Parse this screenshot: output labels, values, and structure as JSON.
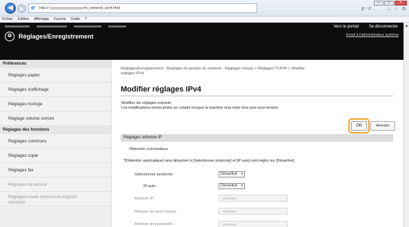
{
  "browser": {
    "url_prefix": "http://",
    "url_suffix": "/m_network_ipv4.html",
    "search_glyphs": "ρ - c",
    "win_min": "—",
    "win_max": "□",
    "win_close": "✕"
  },
  "menubar": [
    "Fichier",
    "Edition",
    "Affichage",
    "Favoris",
    "Outils",
    "?"
  ],
  "header": {
    "portal_link": "Vers le portail",
    "logout_link": "Se déconnecter",
    "admin_email": "Email à l'administrateur système",
    "app_title": "Réglages/Enregistrement"
  },
  "sidebar": {
    "sec1": "Préférences",
    "sec1_items": [
      "Réglages papier",
      "Réglages d'affichage",
      "Réglages horloge",
      "Réglage volume sonore"
    ],
    "sec2": "Réglages des fonctions",
    "sec2_items": [
      "Réglages communs",
      "Réglages copie",
      "Réglages fax",
      "Réglages de lecture"
    ],
    "sec2_last_line1": "Réglages mode impression support",
    "sec2_last_line2": "mémoire"
  },
  "main": {
    "breadcrumb_line1": "Réglages/Enregistrement : Réglages de gestion du système : Réglages réseau > Réglages TCP/IP > Modifier",
    "breadcrumb_line2": "réglages IPv4",
    "title": "Modifier réglages IPv4",
    "desc1": "Modifiez les réglages suivants.",
    "desc2": "Les modifications seront prises en compte lorsque la machine sera mise hors puis sous tension.",
    "ok": "OK",
    "cancel": "Annuler",
    "section": "Réglages adresse IP",
    "auto_label": "Obtention automatique",
    "note": "*[Obtention automatique] sera désactivé si [Sélectionner protocole] et [IP auto] sont réglés sur [Désactivé].",
    "protocol_label": "Sélectionner protocole :",
    "protocol_value": "Désactivé",
    "autoip_label": "IP auto :",
    "autoip_value": "Désactivé",
    "ip_label": "Adresse IP :",
    "mask_label": "Masque de sous-réseau :",
    "gateway_label": "Adresse de passerelle :"
  },
  "colors": {
    "header_bg": "#0d0d0d",
    "ok_highlight": "#f0a020",
    "sidebar_bg": "#efefef"
  }
}
